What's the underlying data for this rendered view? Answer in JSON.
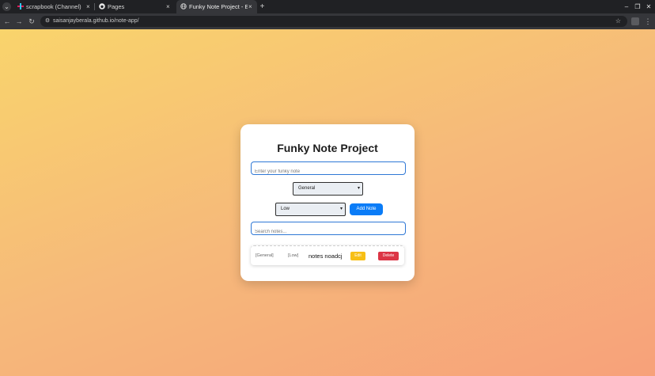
{
  "browser": {
    "tabs": [
      {
        "title": "scrapbook (Channel) - Ha",
        "icon": "slack-icon",
        "active": false
      },
      {
        "title": "Pages",
        "icon": "github-icon",
        "active": false
      },
      {
        "title": "Funky Note Project - Enh",
        "icon": "globe-icon",
        "active": true
      }
    ],
    "new_tab_label": "+",
    "close_label": "×",
    "url": "saisanjayberala.github.io/note-app/",
    "colors": {
      "chrome_dark": "#202124",
      "chrome_toolbar": "#35363a"
    }
  },
  "app": {
    "title": "Funky Note Project",
    "note_input": {
      "placeholder": "Enter your funky note",
      "value": ""
    },
    "category_select": {
      "selected": "General"
    },
    "priority_select": {
      "selected": "Low"
    },
    "add_button_label": "Add Note",
    "search_input": {
      "placeholder": "Search notes...",
      "value": ""
    },
    "notes": [
      {
        "category": "[General]",
        "priority": "[Low]",
        "text": "notes noadcj",
        "edit_label": "Edit",
        "delete_label": "Delete"
      }
    ],
    "colors": {
      "accent": "#0a7cf7",
      "edit": "#f7bf15",
      "delete": "#dc3545",
      "input_border": "#2f78d6",
      "gradient_start": "#f9d46c",
      "gradient_end": "#f7a17a"
    }
  }
}
